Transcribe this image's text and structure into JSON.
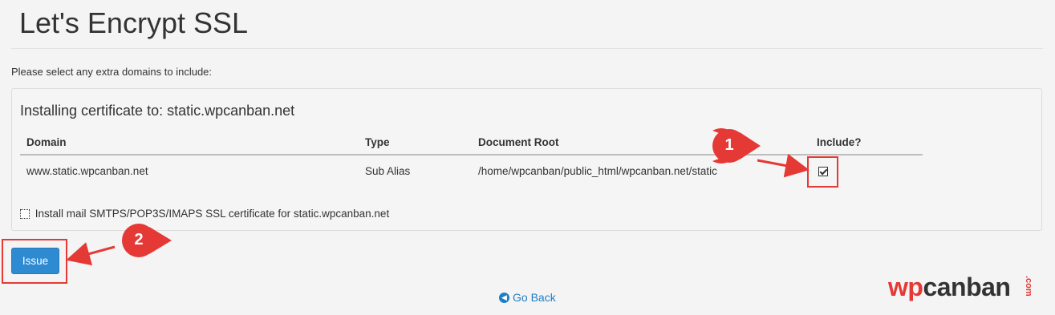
{
  "page": {
    "title": "Let's Encrypt SSL",
    "intro": "Please select any extra domains to include:"
  },
  "panel": {
    "heading": "Installing certificate to: static.wpcanban.net",
    "columns": [
      "Domain",
      "Type",
      "Document Root",
      "Include?"
    ],
    "rows": [
      {
        "domain": "www.static.wpcanban.net",
        "type": "Sub Alias",
        "document_root": "/home/wpcanban/public_html/wpcanban.net/static",
        "include": true
      }
    ],
    "mail_option": {
      "label": "Install mail SMTPS/POP3S/IMAPS SSL certificate for static.wpcanban.net",
      "checked": false
    }
  },
  "actions": {
    "issue_label": "Issue",
    "go_back_label": "Go Back",
    "go_back_icon": "arrow-left-circle-icon"
  },
  "annotations": {
    "badge_1": "1",
    "badge_2": "2",
    "color": "#e53935"
  },
  "logo": {
    "wp": "wp",
    "rest": "canban",
    "com": ".com"
  },
  "colors": {
    "accent": "#2f8bd1",
    "link": "#1f7dc4",
    "background": "#f4f4f4"
  }
}
